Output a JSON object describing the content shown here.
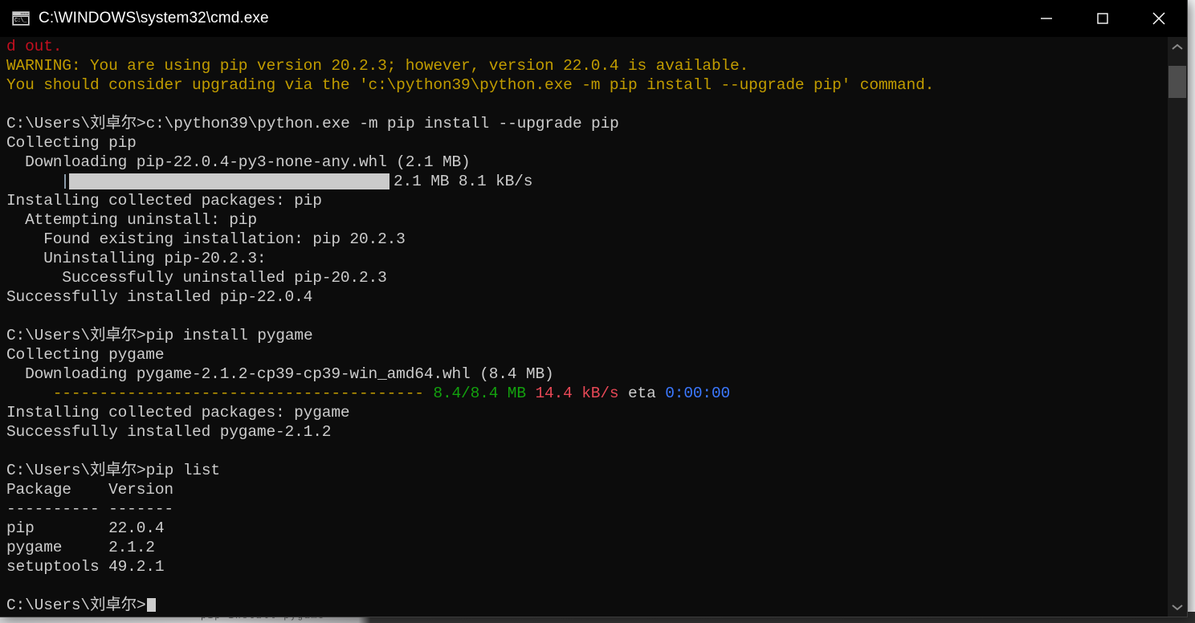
{
  "window": {
    "title": "C:\\WINDOWS\\system32\\cmd.exe",
    "icon": "cmd-console-icon",
    "icon_text": "C:\\_",
    "minimize_label": "Minimize",
    "maximize_label": "Maximize",
    "close_label": "Close"
  },
  "colors": {
    "background": "#0c0c0c",
    "default_text": "#cccccc",
    "red": "#c50f1f",
    "yellow": "#c19c00",
    "green": "#13a10e",
    "bright_red": "#e74856",
    "blue": "#3b78ff",
    "progress_fill": "#cbcbcb",
    "titlebar": "#000000"
  },
  "console": {
    "prompt": "C:\\Users\\刘卓尔>",
    "lines": [
      {
        "id": "l01",
        "color": "red",
        "text": "d out."
      },
      {
        "id": "l02",
        "color": "yellow",
        "text": "WARNING: You are using pip version 20.2.3; however, version 22.0.4 is available."
      },
      {
        "id": "l03",
        "color": "yellow",
        "text": "You should consider upgrading via the 'c:\\python39\\python.exe -m pip install --upgrade pip' command."
      },
      {
        "id": "l04",
        "color": "gray",
        "text": ""
      },
      {
        "id": "l05",
        "color": "gray",
        "text": "C:\\Users\\刘卓尔>c:\\python39\\python.exe -m pip install --upgrade pip"
      },
      {
        "id": "l06",
        "color": "gray",
        "text": "Collecting pip"
      },
      {
        "id": "l07",
        "color": "gray",
        "text": "  Downloading pip-22.0.4-py3-none-any.whl (2.1 MB)"
      },
      {
        "id": "l08",
        "type": "progress",
        "color": "gray",
        "text": "2.1 MB 8.1 kB/s"
      },
      {
        "id": "l09",
        "color": "gray",
        "text": "Installing collected packages: pip"
      },
      {
        "id": "l10",
        "color": "gray",
        "text": "  Attempting uninstall: pip"
      },
      {
        "id": "l11",
        "color": "gray",
        "text": "    Found existing installation: pip 20.2.3"
      },
      {
        "id": "l12",
        "color": "gray",
        "text": "    Uninstalling pip-20.2.3:"
      },
      {
        "id": "l13",
        "color": "gray",
        "text": "      Successfully uninstalled pip-20.2.3"
      },
      {
        "id": "l14",
        "color": "gray",
        "text": "Successfully installed pip-22.0.4"
      },
      {
        "id": "l15",
        "color": "gray",
        "text": ""
      },
      {
        "id": "l16",
        "color": "gray",
        "text": "C:\\Users\\刘卓尔>pip install pygame"
      },
      {
        "id": "l17",
        "color": "gray",
        "text": "Collecting pygame"
      },
      {
        "id": "l18",
        "color": "gray",
        "text": "  Downloading pygame-2.1.2-cp39-cp39-win_amd64.whl (8.4 MB)"
      },
      {
        "id": "l19",
        "type": "segments",
        "segments": [
          {
            "color": "yellow",
            "text": "     ---------------------------------------- "
          },
          {
            "color": "green",
            "text": "8.4/8.4 MB"
          },
          {
            "color": "gray",
            "text": " "
          },
          {
            "color": "bred",
            "text": "14.4 kB/s"
          },
          {
            "color": "gray",
            "text": " eta "
          },
          {
            "color": "blue",
            "text": "0:00:00"
          }
        ]
      },
      {
        "id": "l20",
        "color": "gray",
        "text": "Installing collected packages: pygame"
      },
      {
        "id": "l21",
        "color": "gray",
        "text": "Successfully installed pygame-2.1.2"
      },
      {
        "id": "l22",
        "color": "gray",
        "text": ""
      },
      {
        "id": "l23",
        "color": "gray",
        "text": "C:\\Users\\刘卓尔>pip list"
      },
      {
        "id": "l24",
        "color": "gray",
        "text": "Package    Version"
      },
      {
        "id": "l25",
        "color": "gray",
        "text": "---------- -------"
      },
      {
        "id": "l26",
        "color": "gray",
        "text": "pip        22.0.4"
      },
      {
        "id": "l27",
        "color": "gray",
        "text": "pygame     2.1.2"
      },
      {
        "id": "l28",
        "color": "gray",
        "text": "setuptools 49.2.1"
      },
      {
        "id": "l29",
        "color": "gray",
        "text": ""
      },
      {
        "id": "l30",
        "type": "prompt-cursor",
        "color": "gray",
        "text": "C:\\Users\\刘卓尔>"
      }
    ],
    "pip_list": {
      "headers": [
        "Package",
        "Version"
      ],
      "rows": [
        [
          "pip",
          "22.0.4"
        ],
        [
          "pygame",
          "2.1.2"
        ],
        [
          "setuptools",
          "49.2.1"
        ]
      ]
    },
    "progress_bar": {
      "label": "2.1 MB 8.1 kB/s",
      "percent": 100
    }
  },
  "scrollbar": {
    "up_arrow": "chevron-up-icon",
    "down_arrow": "chevron-down-icon",
    "thumb": "scrollbar-thumb"
  },
  "background": {
    "bottom_text": "pip install pygame"
  }
}
